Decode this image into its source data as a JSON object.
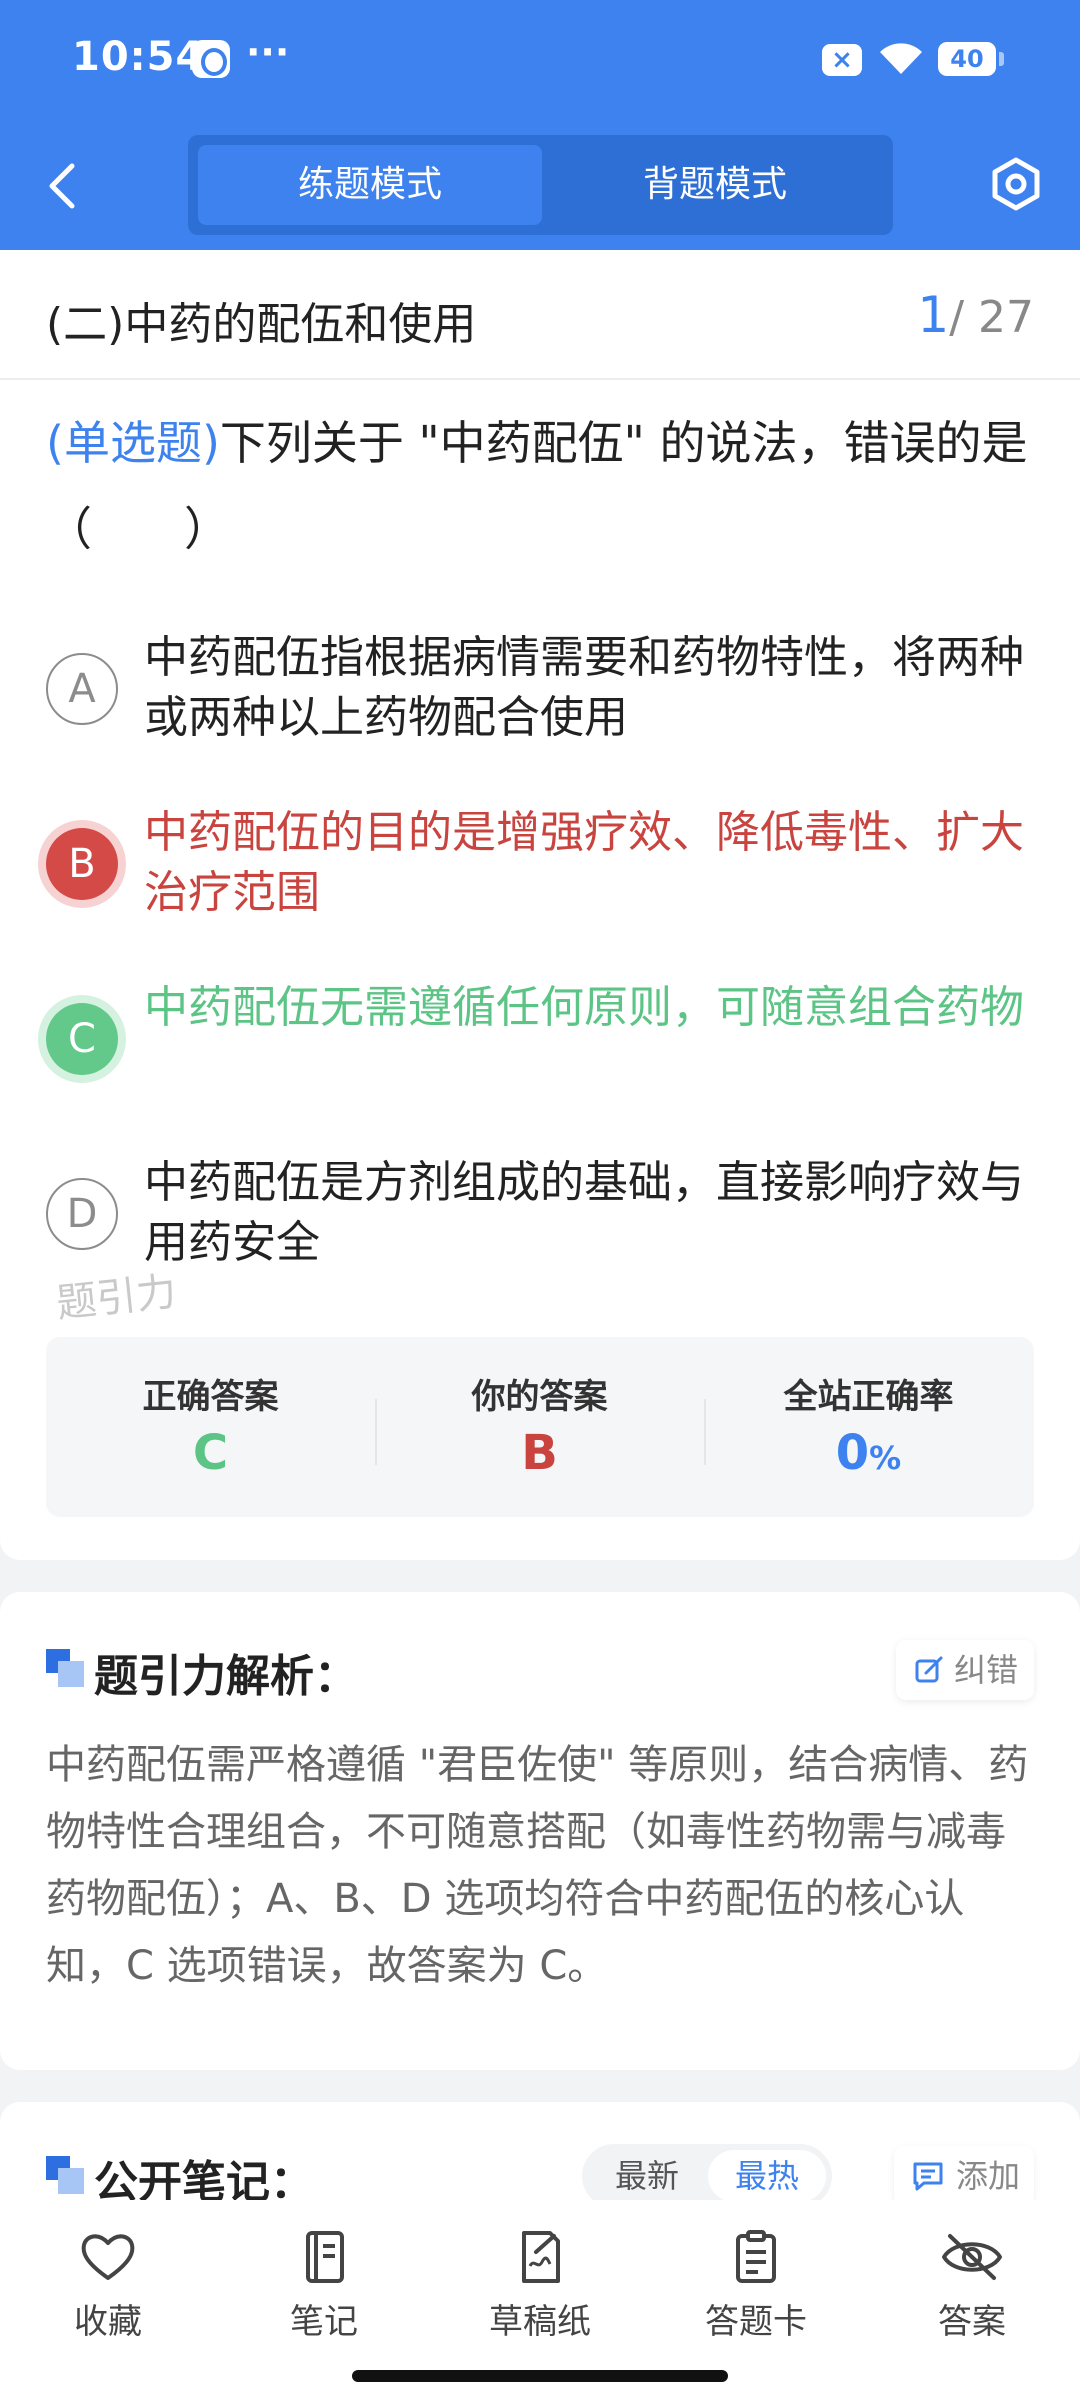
{
  "status_bar": {
    "time": "10:54",
    "dots": "···",
    "battery": "40"
  },
  "header": {
    "modes": [
      {
        "label": "练题模式",
        "active": true
      },
      {
        "label": "背题模式",
        "active": false
      }
    ]
  },
  "chapter": {
    "title": "(二)中药的配伍和使用",
    "current": "1",
    "total": "/ 27"
  },
  "question": {
    "type_label": "(单选题)",
    "stem": "下列关于 \"中药配伍\" 的说法，错误的是（　　）",
    "options": [
      {
        "letter": "A",
        "text": "中药配伍指根据病情需要和药物特性，将两种或两种以上药物配合使用",
        "state": "normal"
      },
      {
        "letter": "B",
        "text": "中药配伍的目的是增强疗效、降低毒性、扩大治疗范围",
        "state": "wrong"
      },
      {
        "letter": "C",
        "text": "中药配伍无需遵循任何原则，可随意组合药物",
        "state": "right"
      },
      {
        "letter": "D",
        "text": "中药配伍是方剂组成的基础，直接影响疗效与用药安全",
        "state": "normal"
      }
    ],
    "watermark": "题引力"
  },
  "answer_summary": {
    "correct_label": "正确答案",
    "correct_value": "C",
    "yours_label": "你的答案",
    "yours_value": "B",
    "rate_label": "全站正确率",
    "rate_value": "0",
    "rate_unit": "%"
  },
  "analysis": {
    "title": "题引力解析：",
    "correct_button": "纠错",
    "text": "中药配伍需严格遵循 \"君臣佐使\" 等原则，结合病情、药物特性合理组合，不可随意搭配（如毒性药物需与减毒药物配伍）；A、B、D 选项均符合中药配伍的核心认知，C 选项错误，故答案为 C。"
  },
  "notes": {
    "title": "公开笔记：",
    "sort_options": [
      "最新",
      "最热"
    ],
    "add_button": "添加"
  },
  "bottom_nav": [
    "收藏",
    "笔记",
    "草稿纸",
    "答题卡",
    "答案"
  ],
  "colors": {
    "primary": "#3d82ee",
    "wrong": "#d44a47",
    "right": "#62c98a"
  }
}
